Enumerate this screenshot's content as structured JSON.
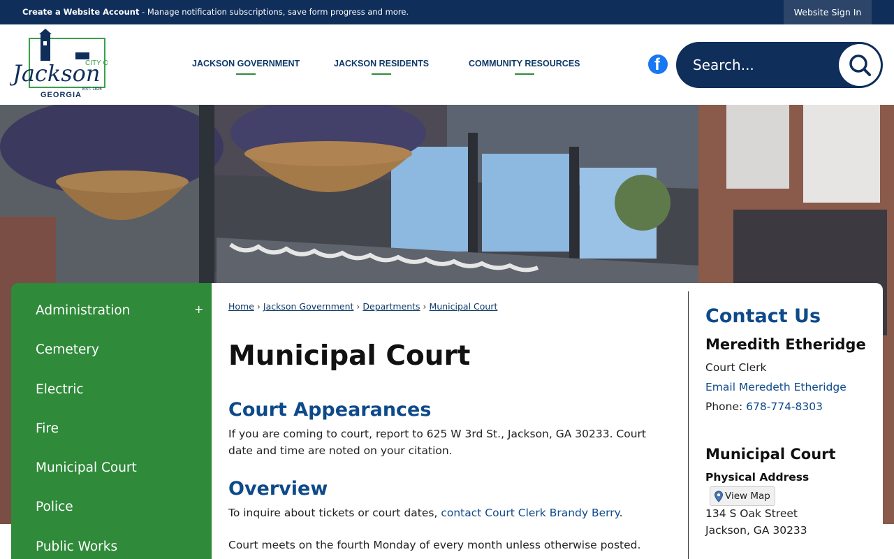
{
  "topbar": {
    "create_account": "Create a Website Account",
    "tagline": " - Manage notification subscriptions, save form progress and more.",
    "sign_in": "Website Sign In"
  },
  "header": {
    "logo": {
      "line1": "CITY OF",
      "line2": "Jackson",
      "est": "EST. 1826",
      "state": "GEORGIA"
    },
    "nav": [
      "JACKSON GOVERNMENT",
      "JACKSON RESIDENTS",
      "COMMUNITY RESOURCES"
    ],
    "search_placeholder": "Search..."
  },
  "sidebar": {
    "items": [
      "Administration",
      "Cemetery",
      "Electric",
      "Fire",
      "Municipal Court",
      "Police",
      "Public Works"
    ],
    "expand_symbol": "+"
  },
  "breadcrumb": [
    "Home",
    "Jackson Government",
    "Departments",
    "Municipal Court"
  ],
  "main": {
    "title": "Municipal Court",
    "section1_title": "Court Appearances",
    "section1_text": "If you are coming to court, report to 625 W 3rd St., Jackson, GA 30233. Court date and time are noted on your citation.",
    "section2_title": "Overview",
    "section2_text_before": "To inquire about tickets or court dates, ",
    "section2_link": "contact Court Clerk Brandy Berry",
    "section2_text_after": ".",
    "section2_text2": "Court meets on the fourth Monday of every month unless otherwise posted."
  },
  "contact": {
    "title": "Contact Us",
    "name": "Meredith Etheridge",
    "role": "Court Clerk",
    "email_link": "Email Meredeth Etheridge",
    "phone_label": "Phone: ",
    "phone": "678-774-8303",
    "dept": "Municipal Court",
    "address_label": "Physical Address",
    "view_map": "View Map",
    "street": "134 S Oak Street",
    "city": "Jackson, GA 30233"
  },
  "colors": {
    "navy": "#0f2e5a",
    "green": "#2f8a3a",
    "link_blue": "#0e4a8a"
  }
}
